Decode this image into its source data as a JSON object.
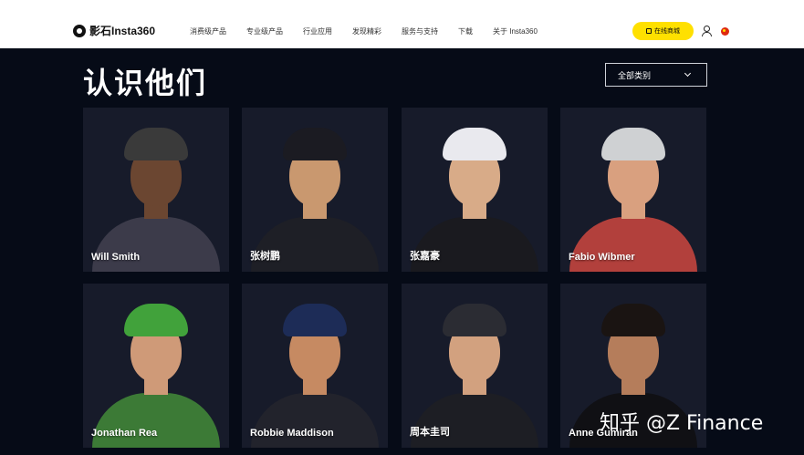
{
  "brand": {
    "name": "影石Insta360"
  },
  "nav": {
    "items": [
      "消费级产品",
      "专业级产品",
      "行业应用",
      "发现精彩",
      "服务与支持",
      "下载",
      "关于 Insta360"
    ],
    "store_label": "在线商城"
  },
  "page": {
    "title": "认识他们",
    "category_filter": "全部类别"
  },
  "people": [
    {
      "name": "Will Smith",
      "skin": "#6b4631",
      "hat": "#3a3a3a",
      "shirt": "#3c3b4a"
    },
    {
      "name": "张树鹏",
      "skin": "#c9986f",
      "hat": "#1b1b22",
      "shirt": "#1e1f26"
    },
    {
      "name": "张嘉豪",
      "skin": "#d8ab88",
      "hat": "#e9e9ee",
      "shirt": "#1a1a1f"
    },
    {
      "name": "Fabio Wibmer",
      "skin": "#d9a07f",
      "hat": "#cfd1d3",
      "shirt": "#b2403c"
    },
    {
      "name": "Jonathan Rea",
      "skin": "#cf9a78",
      "hat": "#41a23b",
      "shirt": "#3c7a36"
    },
    {
      "name": "Robbie Maddison",
      "skin": "#c68a62",
      "hat": "#1d2c57",
      "shirt": "#22232c"
    },
    {
      "name": "周本圭司",
      "skin": "#d2a17f",
      "hat": "#2b2c33",
      "shirt": "#1d1e24"
    },
    {
      "name": "Anne Gumiran",
      "skin": "#b57d5b",
      "hat": "#1a1412",
      "shirt": "#101014"
    }
  ],
  "watermark": "知乎 @Z Finance"
}
